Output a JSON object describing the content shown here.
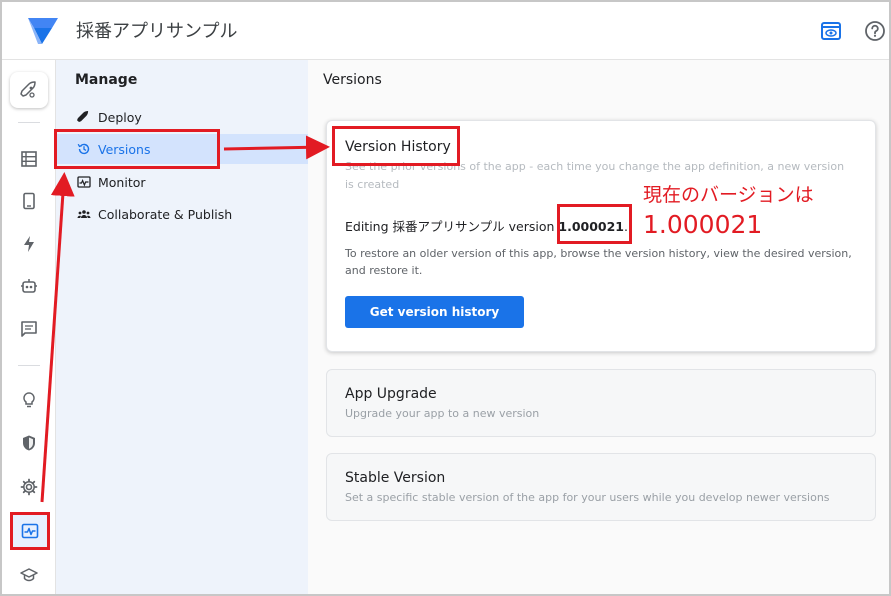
{
  "header": {
    "app_title": "採番アプリサンプル",
    "preview_icon": "eye-preview-icon",
    "help_icon": "help-icon",
    "brand_color": "#1a73e8"
  },
  "rail": {
    "items": [
      {
        "name": "rocket-icon"
      },
      {
        "name": "data-icon"
      },
      {
        "name": "views-icon"
      },
      {
        "name": "automation-icon"
      },
      {
        "name": "bot-icon"
      },
      {
        "name": "chat-icon"
      },
      {
        "name": "intelligence-icon"
      },
      {
        "name": "security-icon"
      },
      {
        "name": "settings-icon"
      },
      {
        "name": "manage-icon"
      },
      {
        "name": "learn-icon"
      }
    ]
  },
  "nav": {
    "heading": "Manage",
    "items": [
      {
        "label": "Deploy",
        "icon": "rocket-icon"
      },
      {
        "label": "Versions",
        "icon": "history-icon"
      },
      {
        "label": "Monitor",
        "icon": "monitor-icon"
      },
      {
        "label": "Collaborate & Publish",
        "icon": "people-icon"
      }
    ]
  },
  "main": {
    "title": "Versions",
    "version_history": {
      "title": "Version History",
      "subtitle": "See the prior versions of the app - each time you change the app definition, a new version is created",
      "editing_prefix": "Editing 採番アプリサンプル version ",
      "version": "1.000021",
      "editing_suffix": ".",
      "restore_text": "To restore an older version of this app, browse the version history, view the desired version, and restore it.",
      "button": "Get version history"
    },
    "app_upgrade": {
      "title": "App Upgrade",
      "subtitle": "Upgrade your app to a new version"
    },
    "stable_version": {
      "title": "Stable Version",
      "subtitle": "Set a specific stable version of the app for your users while you develop newer versions"
    }
  },
  "annotation": {
    "line1": "現在のバージョンは",
    "line2": "1.000021",
    "color": "#e21b23"
  }
}
